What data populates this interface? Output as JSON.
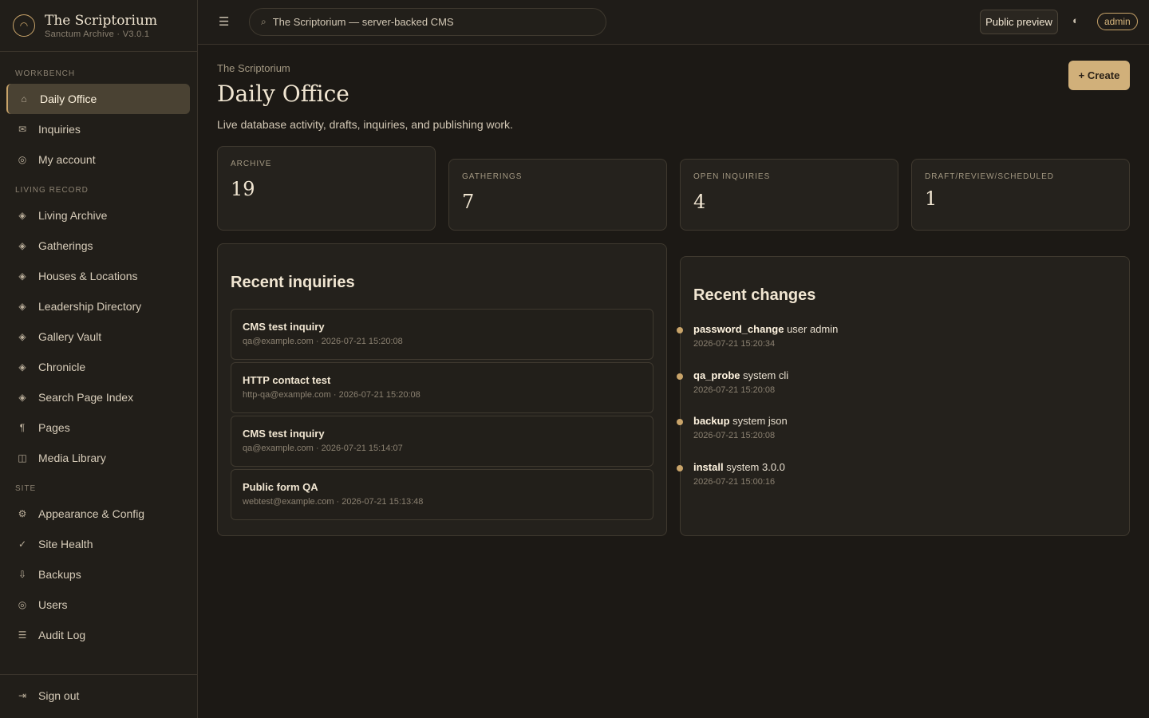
{
  "brand": {
    "title": "The Scriptorium",
    "subtitle": "Sanctum Archive · V3.0.1",
    "logo_icon": "ring-logo-icon"
  },
  "sidebar": {
    "sections": {
      "workbench": "WORKBENCH",
      "living_record": "LIVING RECORD",
      "site": "SITE"
    },
    "items": [
      {
        "label": "Daily Office",
        "icon": "home-icon",
        "active": true
      },
      {
        "label": "Inquiries",
        "icon": "mail-icon"
      },
      {
        "label": "My account",
        "icon": "account-icon"
      },
      {
        "label": "Living Archive",
        "icon": "diamond-icon"
      },
      {
        "label": "Gatherings",
        "icon": "diamond-icon"
      },
      {
        "label": "Houses & Locations",
        "icon": "diamond-icon"
      },
      {
        "label": "Leadership Directory",
        "icon": "diamond-icon"
      },
      {
        "label": "Gallery Vault",
        "icon": "diamond-icon"
      },
      {
        "label": "Chronicle",
        "icon": "diamond-icon"
      },
      {
        "label": "Search Page Index",
        "icon": "diamond-icon"
      },
      {
        "label": "Pages",
        "icon": "pilcrow-icon"
      },
      {
        "label": "Media Library",
        "icon": "media-icon"
      },
      {
        "label": "Appearance & Config",
        "icon": "gear-icon"
      },
      {
        "label": "Site Health",
        "icon": "check-icon"
      },
      {
        "label": "Backups",
        "icon": "download-icon"
      },
      {
        "label": "Users",
        "icon": "users-icon"
      },
      {
        "label": "Audit Log",
        "icon": "list-icon"
      }
    ],
    "sign_out": "Sign out"
  },
  "topbar": {
    "search_text": "The Scriptorium — server-backed CMS",
    "public_preview": "Public preview",
    "user": "admin"
  },
  "main": {
    "breadcrumb": "The Scriptorium",
    "title": "Daily Office",
    "subtitle": "Live database activity, drafts, inquiries, and publishing work.",
    "create_label": "+ Create"
  },
  "stats": [
    {
      "label": "ARCHIVE",
      "value": "19"
    },
    {
      "label": "GATHERINGS",
      "value": "7"
    },
    {
      "label": "OPEN INQUIRIES",
      "value": "4"
    },
    {
      "label": "DRAFT/REVIEW/SCHEDULED",
      "value": "1"
    }
  ],
  "recent_inquiries": {
    "title": "Recent inquiries",
    "items": [
      {
        "title": "CMS test inquiry",
        "meta": "qa@example.com · 2026-07-21 15:20:08"
      },
      {
        "title": "HTTP contact test",
        "meta": "http-qa@example.com · 2026-07-21 15:20:08"
      },
      {
        "title": "CMS test inquiry",
        "meta": "qa@example.com · 2026-07-21 15:14:07"
      },
      {
        "title": "Public form QA",
        "meta": "webtest@example.com · 2026-07-21 15:13:48"
      }
    ]
  },
  "recent_changes": {
    "title": "Recent changes",
    "items": [
      {
        "action": "password_change",
        "detail": "user admin",
        "time": "2026-07-21 15:20:34"
      },
      {
        "action": "qa_probe",
        "detail": "system cli",
        "time": "2026-07-21 15:20:08"
      },
      {
        "action": "backup",
        "detail": "system json",
        "time": "2026-07-21 15:20:08"
      },
      {
        "action": "install",
        "detail": "system 3.0.0",
        "time": "2026-07-21 15:00:16"
      }
    ]
  },
  "colors": {
    "accent": "#c9a46a",
    "background": "#1c1915",
    "panel": "#24211c"
  }
}
